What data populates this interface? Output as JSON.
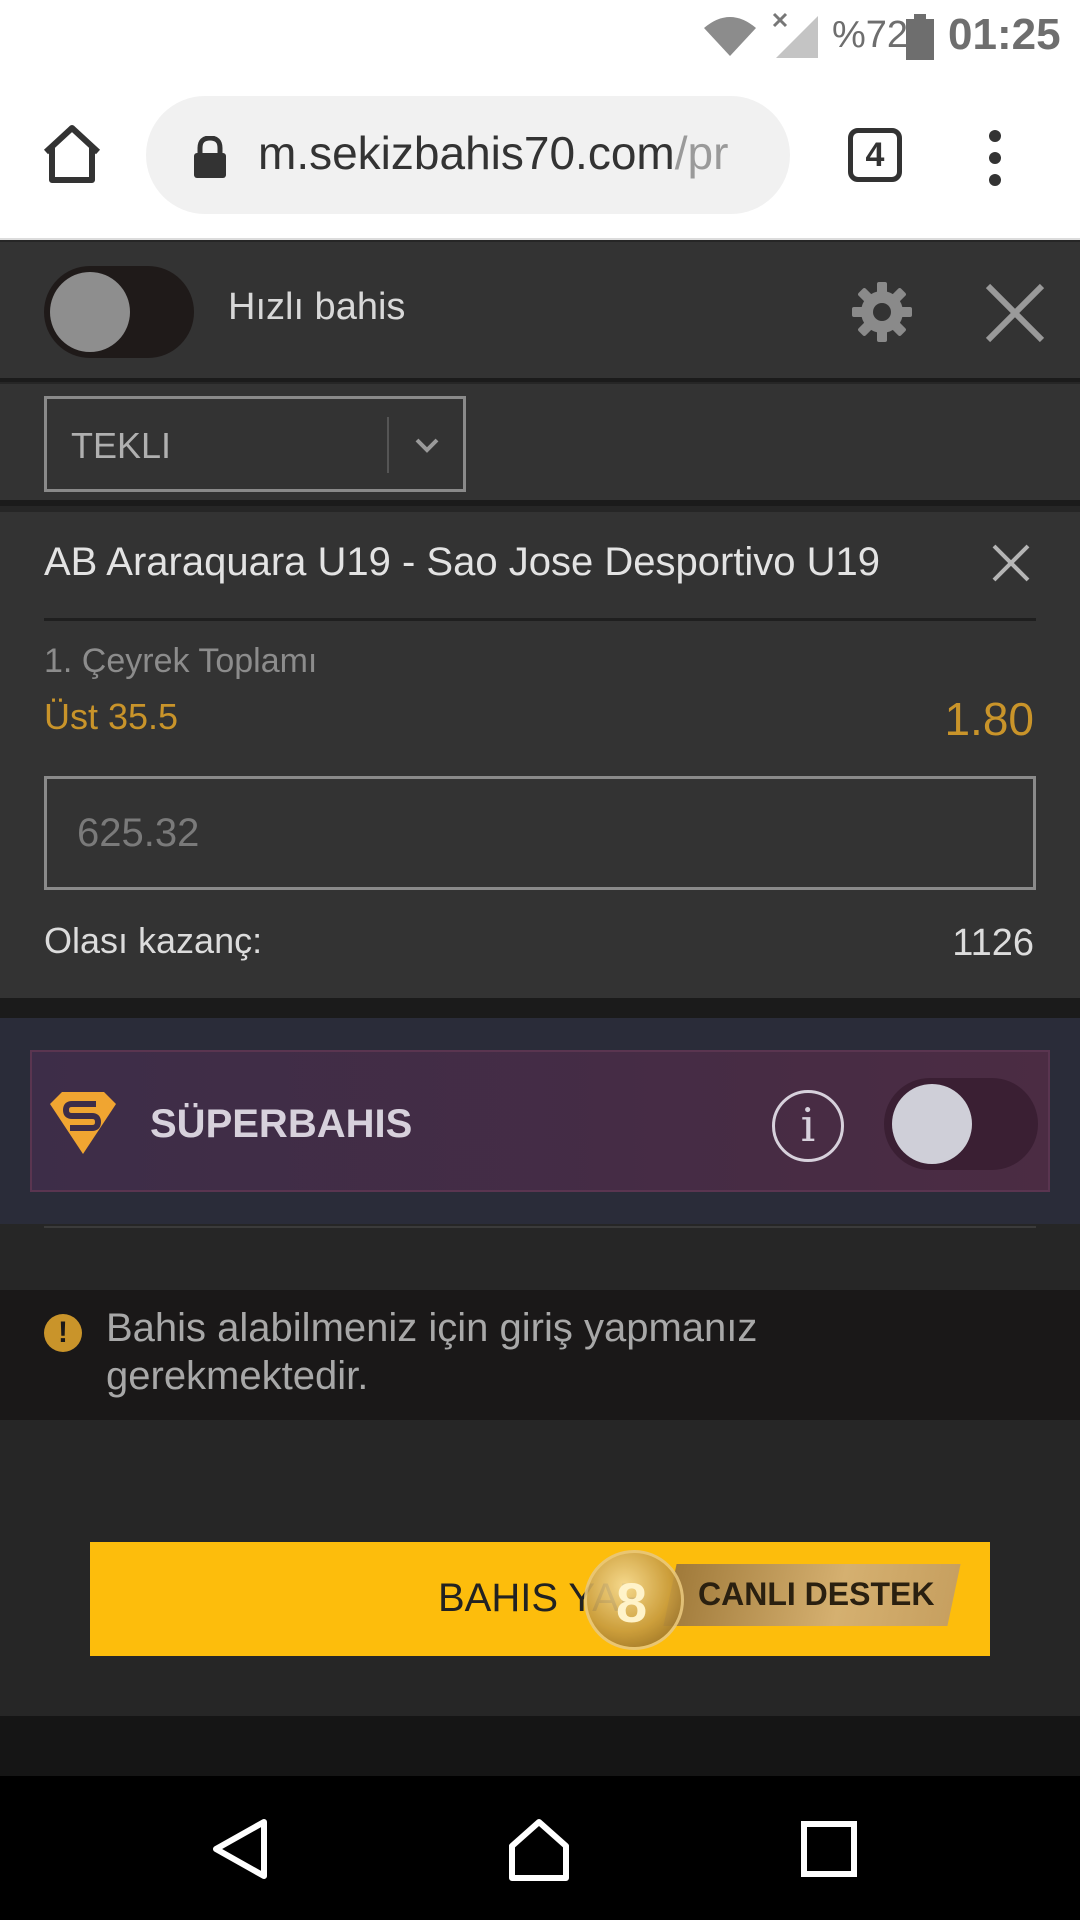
{
  "status_bar": {
    "battery_percent": "%72",
    "time": "01:25",
    "icons": [
      "wifi-icon",
      "no-signal-icon",
      "battery-icon"
    ]
  },
  "browser": {
    "url_main": "m.sekizbahis70.com",
    "url_rest": "/pr",
    "tab_count": "4",
    "icons": [
      "home-icon",
      "lock-icon",
      "tabs-icon",
      "more-vert-icon"
    ]
  },
  "quick_bet": {
    "label": "Hızlı bahis",
    "enabled": false,
    "icons": [
      "gear-icon",
      "close-icon"
    ]
  },
  "bet_type": {
    "selected": "TEKLI"
  },
  "slip": {
    "match": "AB Araraquara U19 - Sao Jose Desportivo U19",
    "market": "1. Çeyrek Toplamı",
    "selection": "Üst 35.5",
    "odds": "1.80",
    "stake_placeholder": "625.32",
    "possible_win_label": "Olası kazanç:",
    "possible_win_value": "1126"
  },
  "superbahis": {
    "title": "SÜPERBAHIS",
    "info_glyph": "i",
    "enabled": false
  },
  "warning": {
    "icon_glyph": "!",
    "text": "Bahis alabilmeniz için giriş yapmanız gerekmektedir."
  },
  "place_bet": {
    "label": "BAHIS YAP"
  },
  "live_support": {
    "label": "CANLI DESTEK",
    "coin_glyph": "8"
  },
  "navigation": {
    "icons": [
      "back-icon",
      "home-icon",
      "recents-icon"
    ]
  },
  "colors": {
    "accent_gold": "#c9942a",
    "button_yellow": "#fdbd0c",
    "panel": "#333333",
    "superbahis_bg": "#4b2c43"
  }
}
